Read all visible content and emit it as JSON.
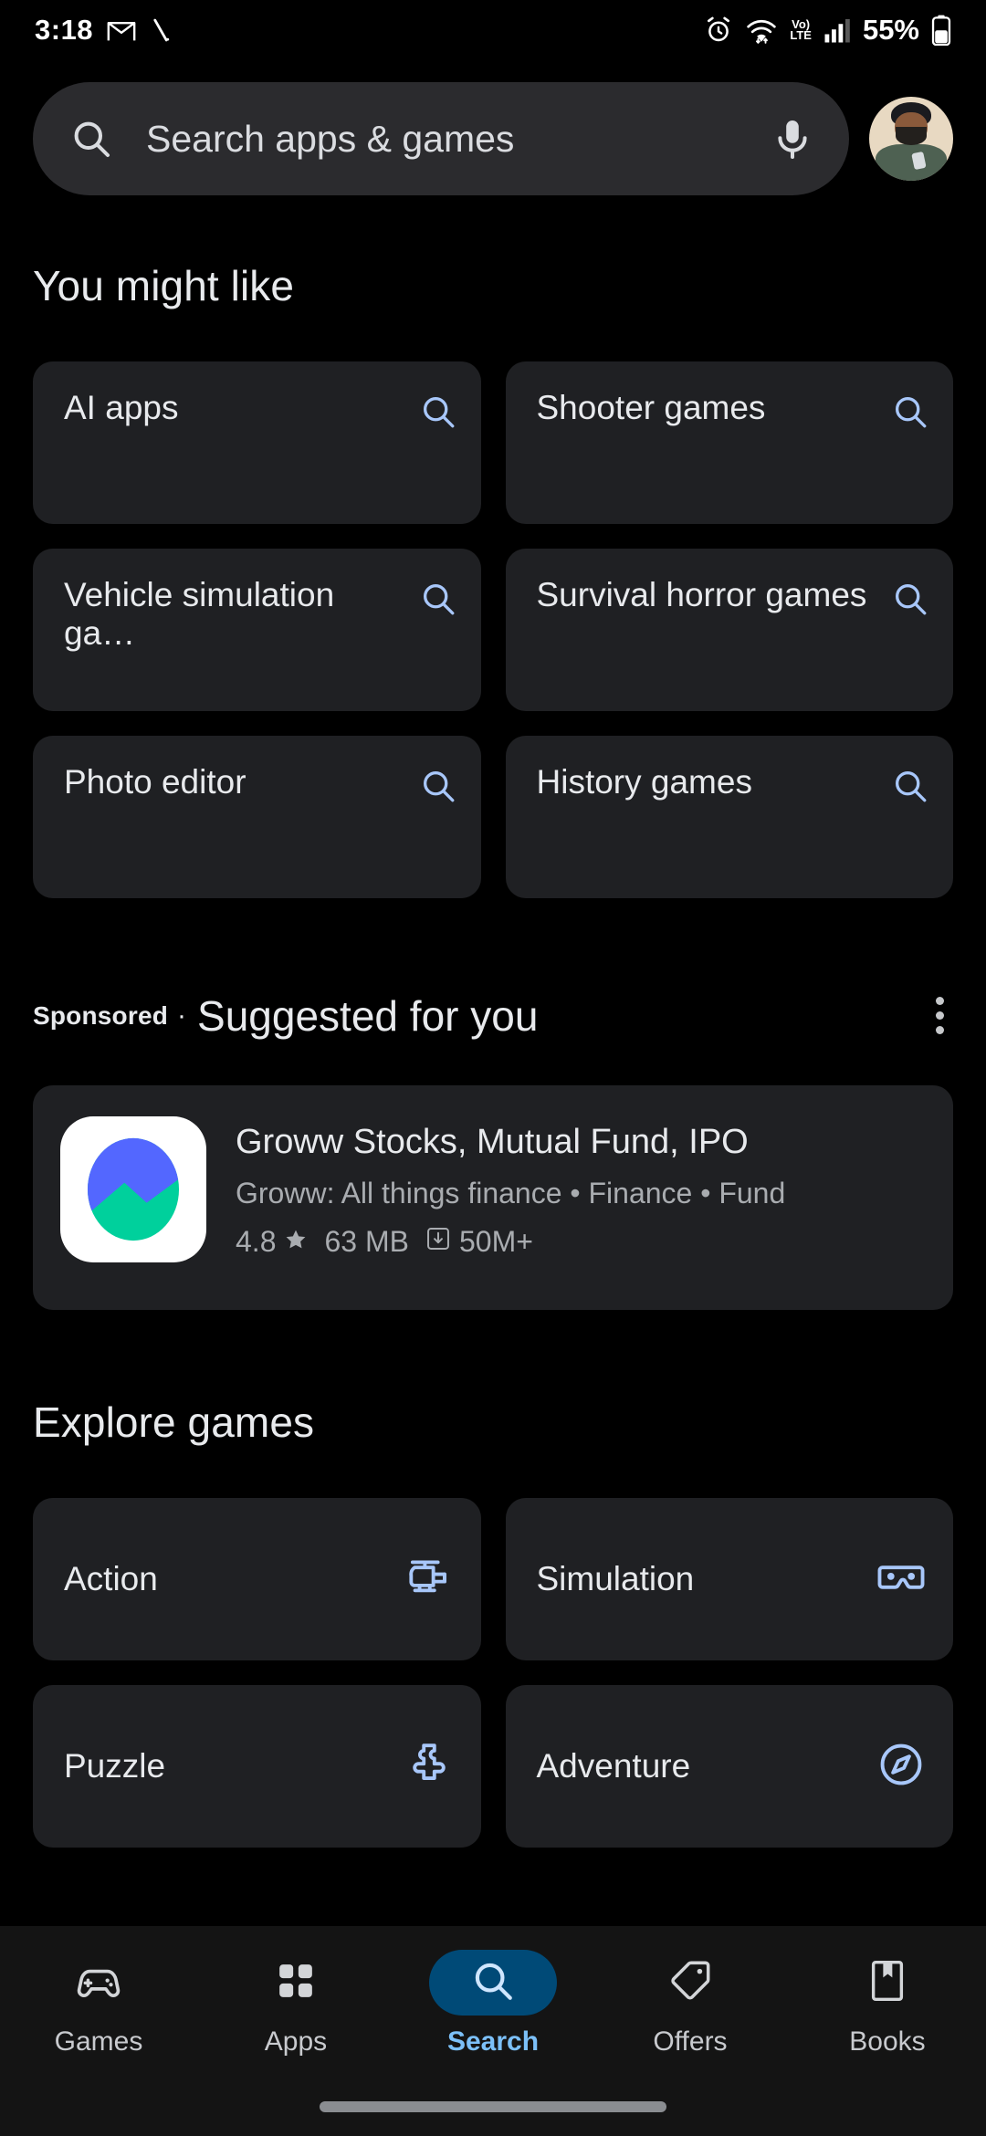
{
  "status_bar": {
    "time": "3:18",
    "left_icons": [
      "gmail-icon",
      "notification-icon"
    ],
    "right_icons": [
      "alarm-icon",
      "wifi-icon",
      "volte-icon",
      "signal-icon"
    ],
    "volte_top": "Vo)",
    "volte_bottom": "LTE",
    "battery_percent": "55%"
  },
  "search": {
    "placeholder": "Search apps & games",
    "search_icon": "search-icon",
    "mic_icon": "microphone-icon",
    "avatar": "account-avatar"
  },
  "you_might_like": {
    "title": "You might like",
    "chips": [
      {
        "label": "AI apps",
        "icon": "search-icon"
      },
      {
        "label": "Shooter games",
        "icon": "search-icon"
      },
      {
        "label": "Vehicle simulation ga…",
        "icon": "search-icon"
      },
      {
        "label": "Survival horror games",
        "icon": "search-icon"
      },
      {
        "label": "Photo editor",
        "icon": "search-icon"
      },
      {
        "label": "History games",
        "icon": "search-icon"
      }
    ]
  },
  "sponsored": {
    "tag": "Sponsored",
    "separator": "·",
    "title": "Suggested for you",
    "overflow_icon": "more-vertical-icon",
    "app": {
      "icon": "groww-app-icon",
      "title": "Groww Stocks, Mutual Fund, IPO",
      "subtitle": "Groww: All things finance • Finance • Fund",
      "rating": "4.8",
      "star_icon": "star-icon",
      "size": "63 MB",
      "download_icon": "download-icon",
      "downloads": "50M+"
    }
  },
  "explore_games": {
    "title": "Explore games",
    "categories": [
      {
        "label": "Action",
        "icon": "helicopter-icon"
      },
      {
        "label": "Simulation",
        "icon": "vr-goggles-icon"
      },
      {
        "label": "Puzzle",
        "icon": "puzzle-piece-icon"
      },
      {
        "label": "Adventure",
        "icon": "compass-icon"
      }
    ]
  },
  "bottom_nav": {
    "items": [
      {
        "label": "Games",
        "icon": "gamepad-icon",
        "active": false
      },
      {
        "label": "Apps",
        "icon": "apps-grid-icon",
        "active": false
      },
      {
        "label": "Search",
        "icon": "search-icon",
        "active": true
      },
      {
        "label": "Offers",
        "icon": "tag-icon",
        "active": false
      },
      {
        "label": "Books",
        "icon": "book-icon",
        "active": false
      }
    ]
  },
  "colors": {
    "background": "#000000",
    "card": "#1f2023",
    "search_bar": "#2b2b2e",
    "accent_blue": "#a8c7fa",
    "active_pill": "#004a77",
    "active_label": "#7cc0f8",
    "secondary_text": "#a9acb0"
  }
}
